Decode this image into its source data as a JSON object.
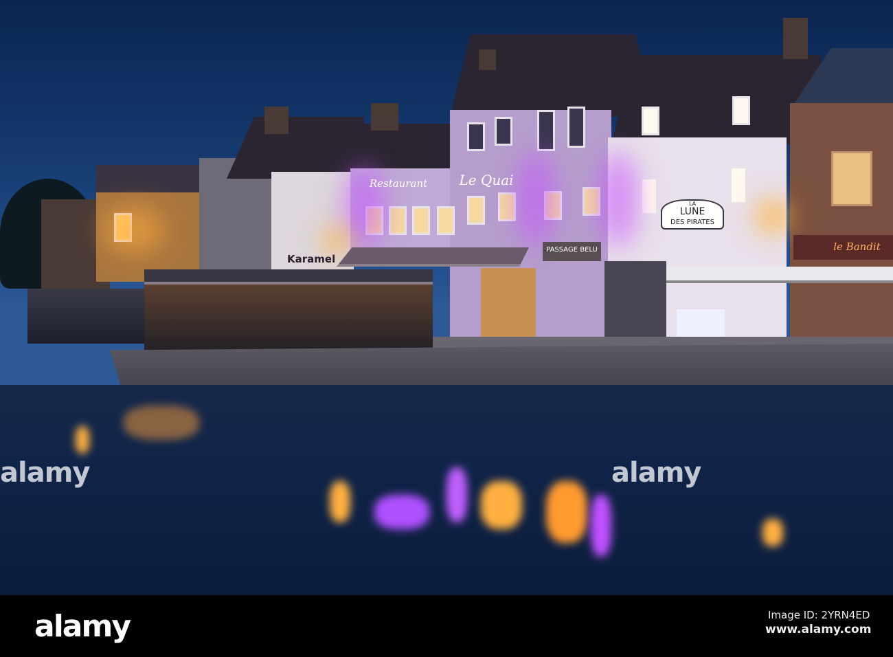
{
  "photo": {
    "signs": {
      "restaurant": "Restaurant",
      "le_quai": "Le Quai",
      "karamel": "Karamel",
      "passage_belu": "PASSAGE BELU",
      "la": "LA",
      "lune": "LUNE",
      "des_pirates": "DES PIRATES",
      "le_bandit": "le Bandit"
    },
    "watermarks": [
      "alamy",
      "alamy"
    ]
  },
  "footer": {
    "logo": "alamy",
    "image_id": "Image ID: 2YRN4ED",
    "url": "www.alamy.com"
  },
  "colors": {
    "sky": "#15386e",
    "neon_purple": "#c040ff",
    "lamp_orange": "#ffb040"
  }
}
